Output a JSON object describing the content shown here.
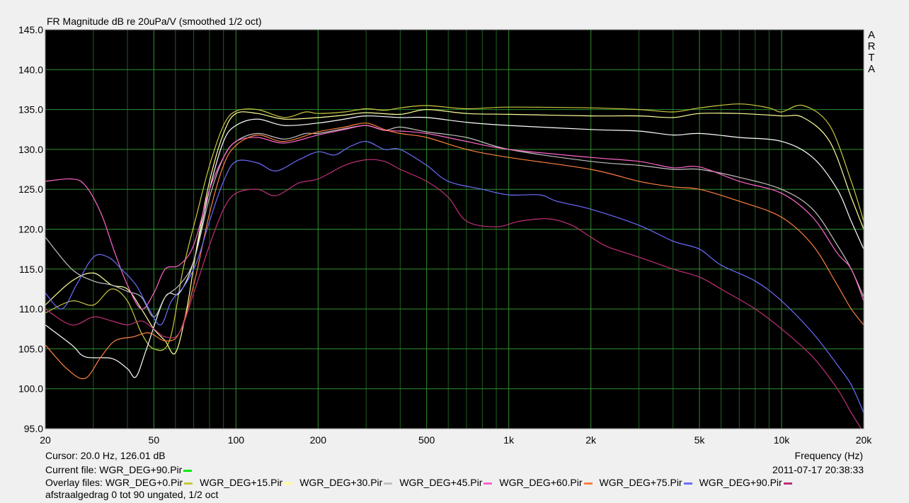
{
  "chart_data": {
    "type": "line",
    "title": "FR Magnitude dB re 20uPa/V (smoothed 1/2 oct)",
    "xlabel": "Frequency (Hz)",
    "ylabel": "",
    "x_scale": "log",
    "xlim": [
      20,
      20000
    ],
    "ylim": [
      95,
      145
    ],
    "grid": true,
    "x_major_ticks": [
      20,
      50,
      100,
      200,
      500,
      1000,
      2000,
      5000,
      10000,
      20000
    ],
    "x_tick_labels": [
      "20",
      "50",
      "100",
      "200",
      "500",
      "1k",
      "2k",
      "5k",
      "10k",
      "20k"
    ],
    "x_minor_grid": [
      30,
      40,
      60,
      70,
      80,
      90,
      300,
      400,
      600,
      700,
      800,
      900,
      3000,
      4000,
      6000,
      7000,
      8000,
      9000
    ],
    "y_ticks": [
      95,
      100,
      105,
      110,
      115,
      120,
      125,
      130,
      135,
      140,
      145
    ],
    "y_tick_labels": [
      "95.0",
      "100.0",
      "105.0",
      "110.0",
      "115.0",
      "120.0",
      "125.0",
      "130.0",
      "135.0",
      "140.0",
      "145.0"
    ],
    "series": [
      {
        "name": "WGR_DEG+0.Pir",
        "color": "#c8c840",
        "points": [
          [
            20,
            109.5
          ],
          [
            25,
            111
          ],
          [
            30,
            110.5
          ],
          [
            35,
            112.5
          ],
          [
            40,
            111
          ],
          [
            45,
            107
          ],
          [
            50,
            105
          ],
          [
            57,
            106
          ],
          [
            64,
            115
          ],
          [
            72,
            122
          ],
          [
            80,
            128
          ],
          [
            90,
            133
          ],
          [
            100,
            134.8
          ],
          [
            120,
            135
          ],
          [
            150,
            134
          ],
          [
            180,
            134.7
          ],
          [
            200,
            134.5
          ],
          [
            250,
            134.7
          ],
          [
            300,
            135.1
          ],
          [
            350,
            134.9
          ],
          [
            400,
            135.2
          ],
          [
            500,
            135.5
          ],
          [
            700,
            135.1
          ],
          [
            1000,
            135.3
          ],
          [
            2000,
            135.2
          ],
          [
            3000,
            135
          ],
          [
            4000,
            134.7
          ],
          [
            5000,
            135.2
          ],
          [
            7000,
            135.7
          ],
          [
            9000,
            135.2
          ],
          [
            10000,
            134.7
          ],
          [
            12000,
            135.5
          ],
          [
            15000,
            133
          ],
          [
            18000,
            126
          ],
          [
            20000,
            121
          ]
        ]
      },
      {
        "name": "WGR_DEG+15.Pir",
        "color": "#ffff99",
        "points": [
          [
            20,
            110.5
          ],
          [
            25,
            113.5
          ],
          [
            30,
            114.5
          ],
          [
            35,
            113
          ],
          [
            40,
            112.5
          ],
          [
            45,
            110
          ],
          [
            50,
            107.5
          ],
          [
            55,
            106
          ],
          [
            60,
            104.5
          ],
          [
            66,
            110
          ],
          [
            72,
            118
          ],
          [
            80,
            126
          ],
          [
            90,
            132
          ],
          [
            100,
            134.5
          ],
          [
            120,
            134.5
          ],
          [
            150,
            133.8
          ],
          [
            200,
            134
          ],
          [
            250,
            134.3
          ],
          [
            300,
            134.6
          ],
          [
            400,
            134.4
          ],
          [
            500,
            135
          ],
          [
            700,
            134.5
          ],
          [
            1000,
            134.4
          ],
          [
            2000,
            134.2
          ],
          [
            3000,
            134.2
          ],
          [
            4000,
            134
          ],
          [
            5000,
            134.5
          ],
          [
            7000,
            134.5
          ],
          [
            10000,
            134.2
          ],
          [
            12000,
            134
          ],
          [
            15000,
            131
          ],
          [
            18000,
            124
          ],
          [
            20000,
            120
          ]
        ]
      },
      {
        "name": "WGR_DEG+30.Pir",
        "color": "#ffffff",
        "points": [
          [
            20,
            108
          ],
          [
            25,
            105.5
          ],
          [
            28,
            104
          ],
          [
            35,
            103.8
          ],
          [
            40,
            102.5
          ],
          [
            43,
            101.5
          ],
          [
            47,
            105
          ],
          [
            55,
            111.5
          ],
          [
            62,
            112
          ],
          [
            70,
            116
          ],
          [
            80,
            125
          ],
          [
            90,
            131
          ],
          [
            100,
            133
          ],
          [
            120,
            133.8
          ],
          [
            150,
            133
          ],
          [
            200,
            133.3
          ],
          [
            250,
            133.8
          ],
          [
            300,
            134.2
          ],
          [
            400,
            134
          ],
          [
            500,
            134
          ],
          [
            700,
            133.4
          ],
          [
            1000,
            133
          ],
          [
            2000,
            132.5
          ],
          [
            3000,
            132.3
          ],
          [
            4000,
            131.8
          ],
          [
            5000,
            132
          ],
          [
            7000,
            131.5
          ],
          [
            10000,
            131
          ],
          [
            13000,
            129
          ],
          [
            16000,
            125
          ],
          [
            18000,
            121
          ],
          [
            20000,
            117.5
          ]
        ]
      },
      {
        "name": "WGR_DEG+45.Pir",
        "color": "#c0c0c0",
        "points": [
          [
            20,
            119
          ],
          [
            25,
            115
          ],
          [
            30,
            113.5
          ],
          [
            35,
            113
          ],
          [
            40,
            112.2
          ],
          [
            45,
            111.5
          ],
          [
            50,
            109
          ],
          [
            55,
            111.5
          ],
          [
            62,
            113
          ],
          [
            70,
            116
          ],
          [
            80,
            124
          ],
          [
            90,
            129
          ],
          [
            100,
            131
          ],
          [
            120,
            132
          ],
          [
            150,
            131.3
          ],
          [
            180,
            132
          ],
          [
            200,
            132
          ],
          [
            250,
            132.6
          ],
          [
            300,
            133
          ],
          [
            350,
            132.4
          ],
          [
            400,
            132.8
          ],
          [
            500,
            132.2
          ],
          [
            700,
            131.5
          ],
          [
            1000,
            130
          ],
          [
            2000,
            128.5
          ],
          [
            3000,
            128
          ],
          [
            4000,
            127.5
          ],
          [
            5000,
            127.5
          ],
          [
            7000,
            126.5
          ],
          [
            10000,
            125
          ],
          [
            13000,
            122.5
          ],
          [
            16000,
            118
          ],
          [
            18000,
            115
          ],
          [
            20000,
            111.5
          ]
        ]
      },
      {
        "name": "WGR_DEG+60.Pir",
        "color": "#ff66cc",
        "points": [
          [
            20,
            126
          ],
          [
            25,
            126.3
          ],
          [
            28,
            125.5
          ],
          [
            32,
            122
          ],
          [
            36,
            117
          ],
          [
            40,
            113
          ],
          [
            45,
            110
          ],
          [
            50,
            112
          ],
          [
            55,
            115
          ],
          [
            62,
            115.5
          ],
          [
            70,
            118
          ],
          [
            80,
            125
          ],
          [
            90,
            129
          ],
          [
            100,
            131
          ],
          [
            120,
            131.5
          ],
          [
            150,
            130.8
          ],
          [
            200,
            131.8
          ],
          [
            250,
            132.5
          ],
          [
            300,
            133
          ],
          [
            350,
            132.4
          ],
          [
            400,
            132.3
          ],
          [
            500,
            132
          ],
          [
            700,
            131
          ],
          [
            1000,
            130
          ],
          [
            2000,
            129
          ],
          [
            3000,
            128.5
          ],
          [
            4000,
            127.7
          ],
          [
            5000,
            127.8
          ],
          [
            7000,
            126
          ],
          [
            10000,
            124.5
          ],
          [
            13000,
            121.5
          ],
          [
            16000,
            117
          ],
          [
            18000,
            115
          ],
          [
            20000,
            111
          ]
        ]
      },
      {
        "name": "WGR_DEG+75.Pir",
        "color": "#ff8040",
        "points": [
          [
            20,
            105.5
          ],
          [
            24,
            102.5
          ],
          [
            28,
            101.3
          ],
          [
            32,
            104
          ],
          [
            36,
            106
          ],
          [
            42,
            106.5
          ],
          [
            48,
            107
          ],
          [
            55,
            106
          ],
          [
            62,
            107
          ],
          [
            70,
            113
          ],
          [
            80,
            122
          ],
          [
            90,
            128
          ],
          [
            100,
            130.5
          ],
          [
            120,
            131.8
          ],
          [
            150,
            131
          ],
          [
            200,
            132.2
          ],
          [
            250,
            132.8
          ],
          [
            300,
            133.3
          ],
          [
            350,
            132.5
          ],
          [
            400,
            132
          ],
          [
            500,
            131.5
          ],
          [
            700,
            130
          ],
          [
            1000,
            129
          ],
          [
            2000,
            127.5
          ],
          [
            3000,
            126
          ],
          [
            4000,
            125.3
          ],
          [
            5000,
            125
          ],
          [
            7000,
            123.5
          ],
          [
            10000,
            121.5
          ],
          [
            13000,
            118
          ],
          [
            16000,
            113
          ],
          [
            18000,
            110
          ],
          [
            20000,
            108
          ]
        ]
      },
      {
        "name": "WGR_DEG+90.Pir",
        "color": "#6d6dff",
        "points": [
          [
            20,
            112
          ],
          [
            23,
            110
          ],
          [
            26,
            113
          ],
          [
            30,
            116.5
          ],
          [
            34,
            116.5
          ],
          [
            38,
            115
          ],
          [
            43,
            113
          ],
          [
            48,
            110
          ],
          [
            53,
            108
          ],
          [
            58,
            111
          ],
          [
            65,
            113
          ],
          [
            72,
            116
          ],
          [
            80,
            121
          ],
          [
            90,
            126
          ],
          [
            100,
            128.5
          ],
          [
            120,
            128.3
          ],
          [
            140,
            127.3
          ],
          [
            170,
            128.7
          ],
          [
            200,
            129.7
          ],
          [
            230,
            129.3
          ],
          [
            260,
            130.3
          ],
          [
            300,
            131
          ],
          [
            350,
            130
          ],
          [
            400,
            130
          ],
          [
            500,
            128
          ],
          [
            600,
            126
          ],
          [
            800,
            125
          ],
          [
            1000,
            124.3
          ],
          [
            1300,
            124.3
          ],
          [
            1500,
            123.5
          ],
          [
            2000,
            122.5
          ],
          [
            3000,
            120.5
          ],
          [
            4000,
            118.5
          ],
          [
            5000,
            117.5
          ],
          [
            6000,
            115.5
          ],
          [
            8000,
            113.5
          ],
          [
            10000,
            111
          ],
          [
            13000,
            107
          ],
          [
            16000,
            103
          ],
          [
            18000,
            100.5
          ],
          [
            20000,
            97
          ]
        ]
      },
      {
        "name": "",
        "color": "#c0307a",
        "points": [
          [
            20,
            110
          ],
          [
            25,
            108
          ],
          [
            30,
            109
          ],
          [
            35,
            108.5
          ],
          [
            40,
            108
          ],
          [
            45,
            108.5
          ],
          [
            50,
            107.5
          ],
          [
            55,
            106.5
          ],
          [
            62,
            107
          ],
          [
            70,
            112
          ],
          [
            80,
            118
          ],
          [
            90,
            122.5
          ],
          [
            100,
            124.5
          ],
          [
            120,
            125
          ],
          [
            140,
            124.2
          ],
          [
            170,
            125.8
          ],
          [
            200,
            126.3
          ],
          [
            250,
            128
          ],
          [
            300,
            128.7
          ],
          [
            350,
            128.5
          ],
          [
            400,
            127.5
          ],
          [
            500,
            126
          ],
          [
            600,
            124
          ],
          [
            700,
            121
          ],
          [
            900,
            120.3
          ],
          [
            1100,
            121
          ],
          [
            1400,
            121.3
          ],
          [
            1700,
            120.5
          ],
          [
            2000,
            119
          ],
          [
            2300,
            117.8
          ],
          [
            3000,
            116.5
          ],
          [
            4000,
            115
          ],
          [
            5000,
            114
          ],
          [
            6000,
            112.5
          ],
          [
            8000,
            110
          ],
          [
            10000,
            107.5
          ],
          [
            13000,
            104
          ],
          [
            16000,
            100
          ],
          [
            18000,
            97
          ],
          [
            20000,
            94.5
          ]
        ]
      }
    ]
  },
  "brand": [
    "A",
    "R",
    "T",
    "A"
  ],
  "cursor_text": "Cursor: 20.0 Hz, 126.01 dB",
  "current_file": {
    "label": "Current file: WGR_DEG+90.Pir",
    "color": "#00ee00"
  },
  "timestamp": "2011-07-17   20:38:33",
  "overlay": {
    "label": "Overlay files:",
    "files": [
      {
        "name": "WGR_DEG+0.Pir",
        "color": "#c8c840"
      },
      {
        "name": "WGR_DEG+15.Pir",
        "color": "#ffff99"
      },
      {
        "name": "WGR_DEG+30.Pir",
        "color": "#c0c0c0"
      },
      {
        "name": "WGR_DEG+45.Pir",
        "color": "#ff66cc"
      },
      {
        "name": "WGR_DEG+60.Pir",
        "color": "#ff8040"
      },
      {
        "name": "WGR_DEG+75.Pir",
        "color": "#6d6dff"
      },
      {
        "name": "WGR_DEG+90.Pir",
        "color": "#c0307a"
      }
    ]
  },
  "comment": "afstraalgedrag 0 tot 90 ungated, 1/2 oct"
}
